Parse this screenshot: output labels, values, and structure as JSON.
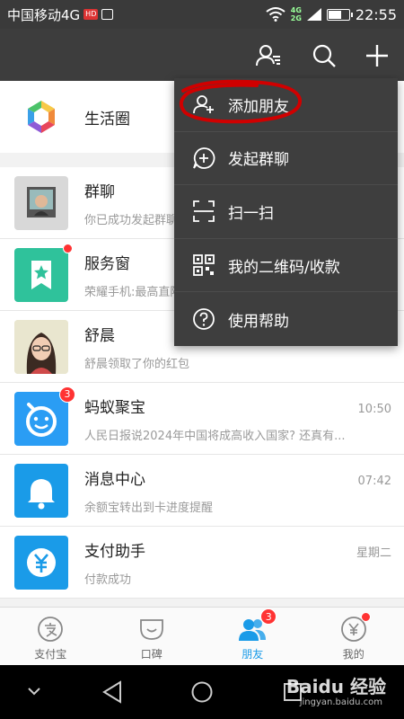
{
  "status": {
    "carrier": "中国移动4G",
    "hd_badge": "HD",
    "net_4g": "4G",
    "net_2g": "2G",
    "time": "22:55"
  },
  "header": {
    "contacts_icon": "contacts-icon",
    "search_icon": "search-icon",
    "add_icon": "plus-icon"
  },
  "life_circle": {
    "label": "生活圈"
  },
  "chats": [
    {
      "title": "群聊",
      "time": "",
      "sub": "你已成功发起群聊"
    },
    {
      "title": "服务窗",
      "time": "",
      "sub": "荣耀手机:最高直降"
    },
    {
      "title": "舒晨",
      "time": "",
      "sub": "舒晨领取了你的红包"
    },
    {
      "title": "蚂蚁聚宝",
      "time": "10:50",
      "sub": "人民日报说2024年中国将成高收入国家? 还真有...",
      "badge": "3"
    },
    {
      "title": "消息中心",
      "time": "07:42",
      "sub": "余额宝转出到卡进度提醒"
    },
    {
      "title": "支付助手",
      "time": "星期二",
      "sub": "付款成功"
    }
  ],
  "menu": {
    "items": [
      {
        "label": "添加朋友",
        "icon": "add-friend-icon"
      },
      {
        "label": "发起群聊",
        "icon": "group-chat-icon"
      },
      {
        "label": "扫一扫",
        "icon": "scan-icon"
      },
      {
        "label": "我的二维码/收款",
        "icon": "qr-code-icon"
      },
      {
        "label": "使用帮助",
        "icon": "help-icon"
      }
    ]
  },
  "tabs": [
    {
      "label": "支付宝",
      "icon": "alipay-icon"
    },
    {
      "label": "口碑",
      "icon": "koubei-icon"
    },
    {
      "label": "朋友",
      "icon": "friends-icon",
      "badge": "3"
    },
    {
      "label": "我的",
      "icon": "me-icon"
    }
  ],
  "watermark": {
    "brand": "Baidu 经验",
    "url": "jingyan.baidu.com"
  },
  "colors": {
    "topbar": "#3d3d3d",
    "menu_bg": "#3e3e3e",
    "accent_blue": "#1a9be8",
    "badge_red": "#f33",
    "highlight_circle": "#d00000"
  }
}
